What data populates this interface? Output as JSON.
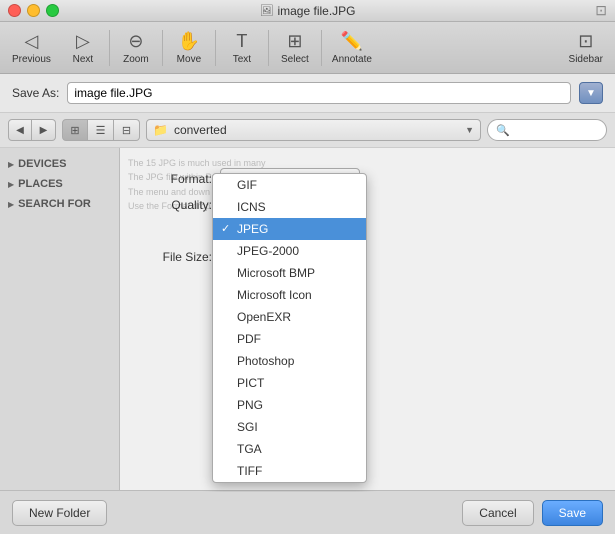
{
  "window": {
    "title": "image file.JPG",
    "title_icon": "🖼"
  },
  "toolbar": {
    "previous_label": "Previous",
    "next_label": "Next",
    "zoom_label": "Zoom",
    "move_label": "Move",
    "text_label": "Text",
    "select_label": "Select",
    "annotate_label": "Annotate",
    "sidebar_label": "Sidebar"
  },
  "save_as": {
    "label": "Save As:",
    "value": "image file.JPG"
  },
  "nav": {
    "folder_name": "converted",
    "search_placeholder": ""
  },
  "sidebar": {
    "sections": [
      {
        "label": "DEVICES"
      },
      {
        "label": "PLACES"
      },
      {
        "label": "SEARCH FOR"
      }
    ]
  },
  "format_section": {
    "format_label": "Format:",
    "quality_label": "Quality:",
    "filesize_label": "File Size:",
    "selected_format": "JPEG"
  },
  "dropdown": {
    "items": [
      {
        "label": "GIF",
        "selected": false
      },
      {
        "label": "ICNS",
        "selected": false
      },
      {
        "label": "JPEG",
        "selected": true
      },
      {
        "label": "JPEG-2000",
        "selected": false
      },
      {
        "label": "Microsoft BMP",
        "selected": false
      },
      {
        "label": "Microsoft Icon",
        "selected": false
      },
      {
        "label": "OpenEXR",
        "selected": false
      },
      {
        "label": "PDF",
        "selected": false
      },
      {
        "label": "Photoshop",
        "selected": false
      },
      {
        "label": "PICT",
        "selected": false
      },
      {
        "label": "PNG",
        "selected": false
      },
      {
        "label": "SGI",
        "selected": false
      },
      {
        "label": "TGA",
        "selected": false
      },
      {
        "label": "TIFF",
        "selected": false
      }
    ]
  },
  "bottom": {
    "new_folder": "New Folder",
    "cancel": "Cancel",
    "save": "Save"
  }
}
